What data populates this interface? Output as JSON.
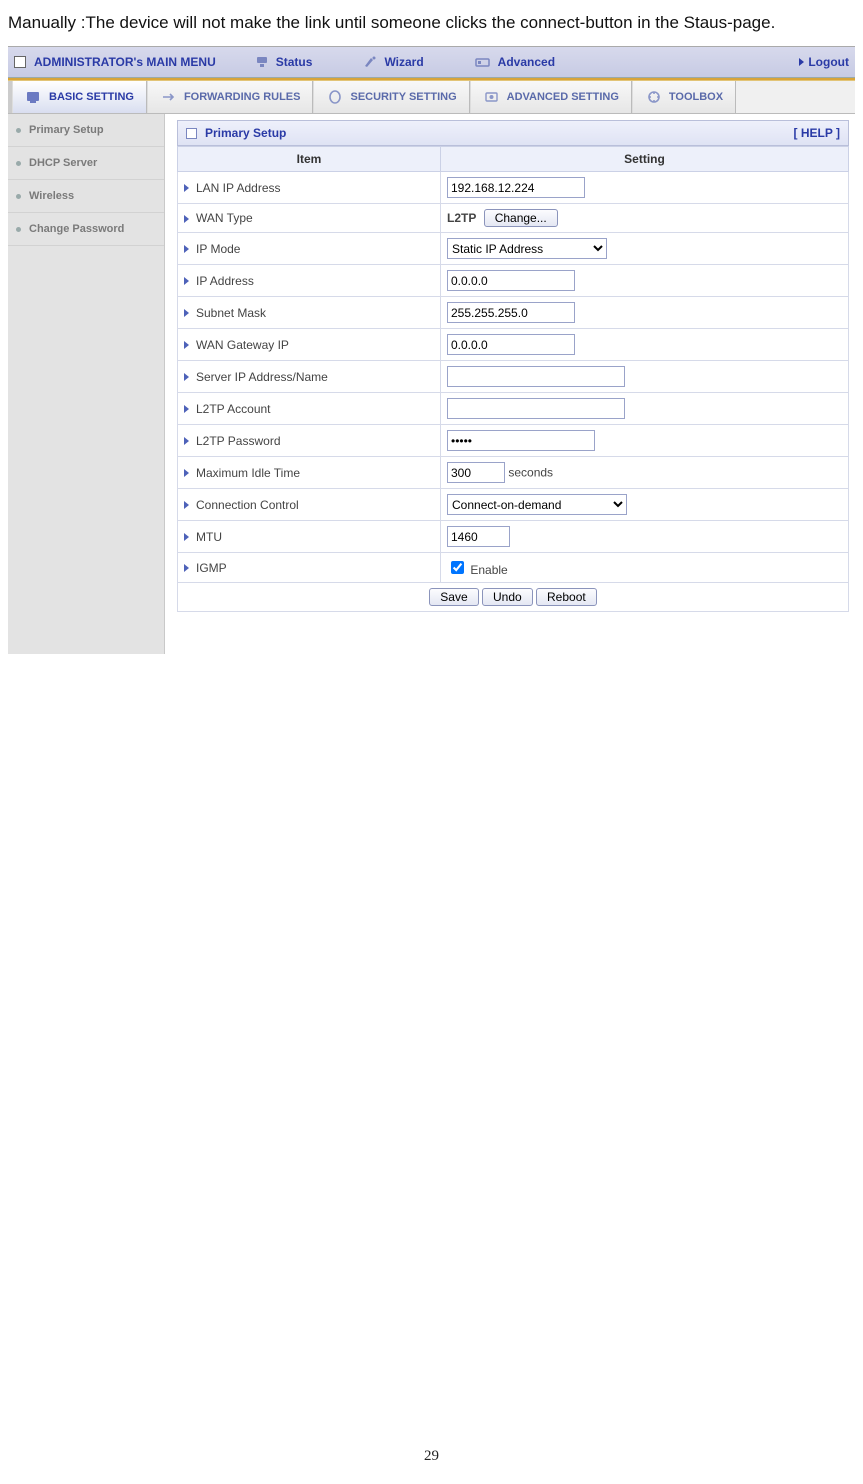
{
  "intro_text": "Manually :The device will not make the link until someone clicks the connect-button in the Staus-page.",
  "topbar": {
    "brand": "ADMINISTRATOR's MAIN MENU",
    "items": [
      {
        "label": "Status"
      },
      {
        "label": "Wizard"
      },
      {
        "label": "Advanced"
      }
    ],
    "logout": "Logout"
  },
  "tabs": [
    {
      "label": "BASIC SETTING",
      "active": true
    },
    {
      "label": "FORWARDING RULES"
    },
    {
      "label": "SECURITY SETTING"
    },
    {
      "label": "ADVANCED SETTING"
    },
    {
      "label": "TOOLBOX"
    }
  ],
  "sidebar": {
    "items": [
      {
        "label": "Primary Setup"
      },
      {
        "label": "DHCP Server"
      },
      {
        "label": "Wireless"
      },
      {
        "label": "Change Password"
      }
    ]
  },
  "section": {
    "title": "Primary Setup",
    "help": "[ HELP ]",
    "col_item": "Item",
    "col_setting": "Setting"
  },
  "form": {
    "lan_ip_label": "LAN IP Address",
    "lan_ip_value": "192.168.12.224",
    "wan_type_label": "WAN Type",
    "wan_type_value": "L2TP",
    "wan_type_button": "Change...",
    "ip_mode_label": "IP Mode",
    "ip_mode_value": "Static IP Address",
    "ip_addr_label": "IP Address",
    "ip_addr_value": "0.0.0.0",
    "subnet_label": "Subnet Mask",
    "subnet_value": "255.255.255.0",
    "wan_gw_label": "WAN Gateway IP",
    "wan_gw_value": "0.0.0.0",
    "server_ip_label": "Server IP Address/Name",
    "server_ip_value": "",
    "l2tp_acct_label": "L2TP Account",
    "l2tp_acct_value": "",
    "l2tp_pwd_label": "L2TP Password",
    "l2tp_pwd_value": "•••••",
    "max_idle_label": "Maximum Idle Time",
    "max_idle_value": "300",
    "max_idle_unit": "seconds",
    "conn_ctrl_label": "Connection Control",
    "conn_ctrl_value": "Connect-on-demand",
    "mtu_label": "MTU",
    "mtu_value": "1460",
    "igmp_label": "IGMP",
    "igmp_enable": "Enable"
  },
  "buttons": {
    "save": "Save",
    "undo": "Undo",
    "reboot": "Reboot"
  },
  "page_number": "29"
}
